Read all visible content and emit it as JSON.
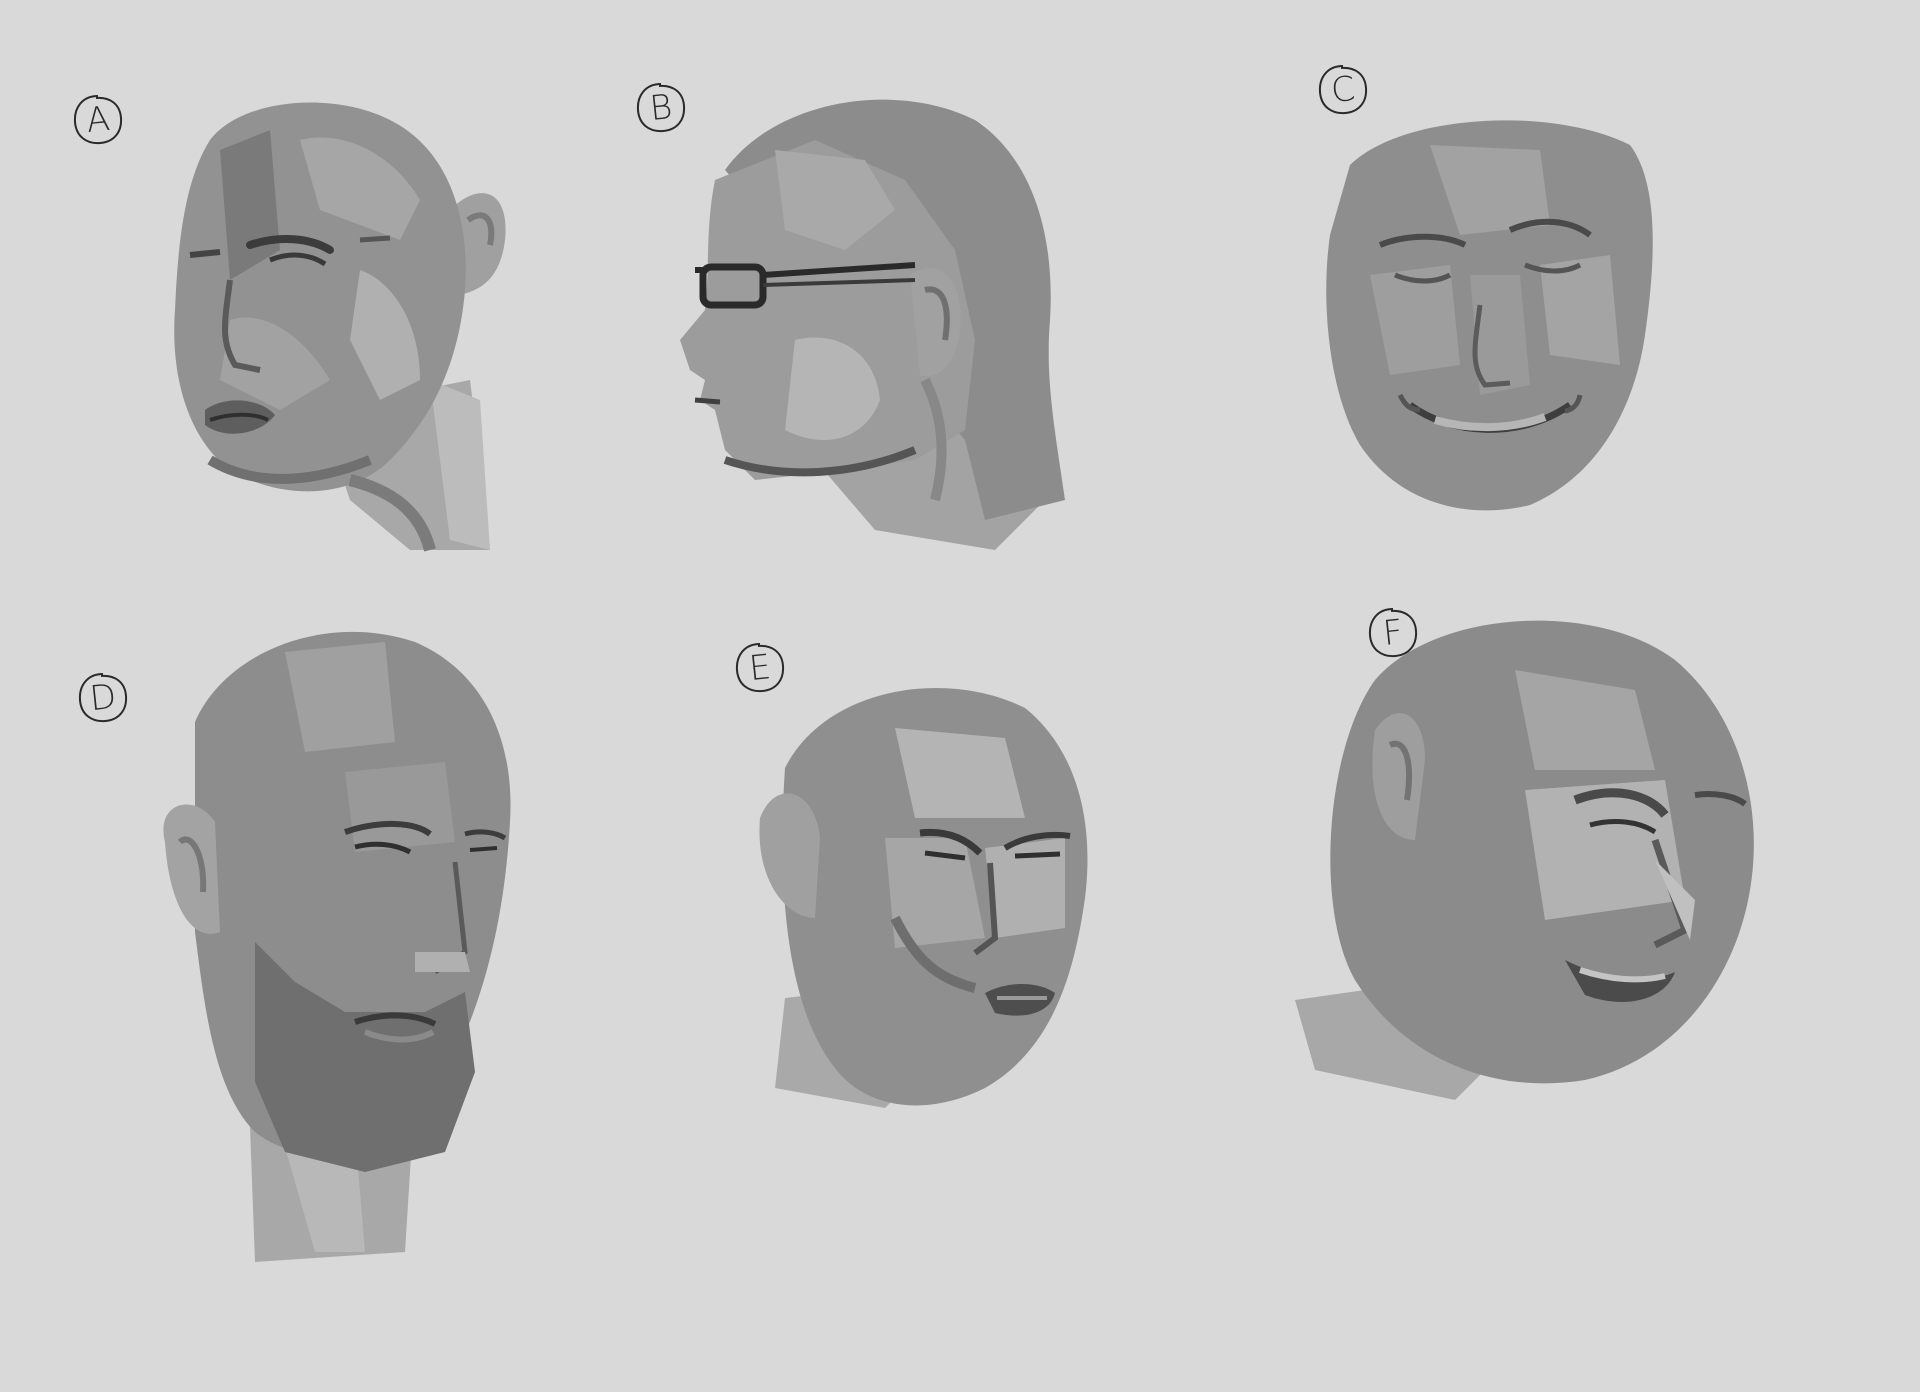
{
  "sketches": [
    {
      "id": "head-a",
      "label": "A"
    },
    {
      "id": "head-b",
      "label": "B"
    },
    {
      "id": "head-c",
      "label": "C"
    },
    {
      "id": "head-d",
      "label": "D"
    },
    {
      "id": "head-e",
      "label": "E"
    },
    {
      "id": "head-f",
      "label": "F"
    }
  ],
  "colors": {
    "background": "#d9d9d9",
    "skin_mid": "#8f8f8f",
    "skin_light": "#b8b8b8",
    "skin_dark": "#6e6e6e",
    "ink": "#2a2a2a"
  }
}
